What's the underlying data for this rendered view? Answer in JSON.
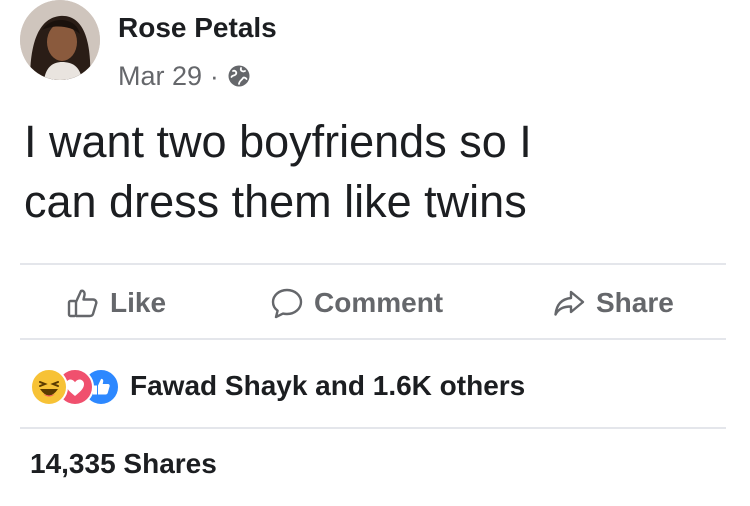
{
  "post": {
    "author": "Rose Petals",
    "date": "Mar 29",
    "separator": "·",
    "privacy_icon": "globe-icon",
    "text_lines": [
      "I want two boyfriends so I",
      "can dress them like twins"
    ]
  },
  "actions": {
    "like": {
      "label": "Like",
      "icon": "thumbs-up-icon"
    },
    "comment": {
      "label": "Comment",
      "icon": "comment-bubble-icon"
    },
    "share": {
      "label": "Share",
      "icon": "share-arrow-icon"
    }
  },
  "reactions": {
    "icons": [
      "haha-reaction-icon",
      "love-reaction-icon",
      "like-reaction-icon"
    ],
    "summary": "Fawad Shayk and 1.6K others"
  },
  "shares": {
    "label": "14,335 Shares"
  },
  "colors": {
    "text": "#1c1e21",
    "secondary_text": "#65676b",
    "divider": "#e4e6eb",
    "haha": "#f7c236",
    "love": "#f0506e",
    "like": "#2d88ff"
  }
}
